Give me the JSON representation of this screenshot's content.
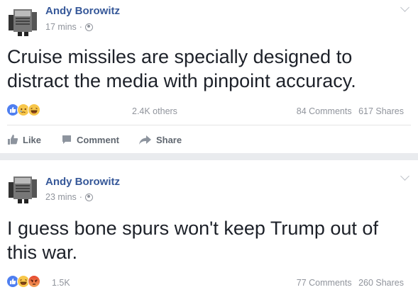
{
  "posts": [
    {
      "author": "Andy Borowitz",
      "time": "17 mins",
      "text": "Cruise missiles are specially designed to distract the media with pinpoint accuracy.",
      "reactions_label": "2.4K others",
      "comments": "84 Comments",
      "shares": "617 Shares",
      "reaction_icons": [
        "like-icon",
        "sad-icon",
        "haha-icon"
      ]
    },
    {
      "author": "Andy Borowitz",
      "time": "23 mins",
      "text": "I guess bone spurs won't keep Trump out of this war.",
      "reactions_label": "1.5K",
      "comments": "77 Comments",
      "shares": "260 Shares",
      "reaction_icons": [
        "like-icon",
        "haha-icon",
        "angry-icon"
      ]
    }
  ],
  "actions": {
    "like": "Like",
    "comment": "Comment",
    "share": "Share"
  },
  "colors": {
    "author": "#365899",
    "meta": "#90949c",
    "like_reaction": "#4f7ff0",
    "haha_reaction": "#f7c64a",
    "angry_reaction": "#e6462f"
  }
}
